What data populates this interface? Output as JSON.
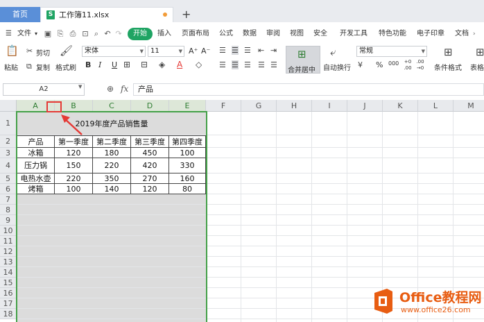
{
  "titlebar": {
    "home_tab": "首页",
    "file_tab": "工作簿11.xlsx",
    "file_icon": "S",
    "new_tab": "+"
  },
  "menubar": {
    "file_menu": "文件",
    "start_tab": "开始",
    "tabs": [
      "插入",
      "页面布局",
      "公式",
      "数据",
      "审阅",
      "视图",
      "安全",
      "开发工具",
      "特色功能",
      "电子印章",
      "文档"
    ]
  },
  "ribbon": {
    "paste": "粘贴",
    "cut": "剪切",
    "copy": "复制",
    "format_painter": "格式刷",
    "font_name": "宋体",
    "font_size": "11",
    "font_grow": "A⁺",
    "font_shrink": "A⁻",
    "bold": "B",
    "italic": "I",
    "underline": "U",
    "font_color_letter": "A",
    "merge_center": "合并居中",
    "wrap_text": "自动换行",
    "number_format": "常规",
    "percent": "%",
    "thousands": "000",
    "inc_decimal_top": "+0",
    "inc_decimal_bottom": ".00",
    "dec_decimal_top": ".00",
    "dec_decimal_bottom": "→0",
    "conditional_format": "条件格式",
    "table_style": "表格",
    "accent_green": "#1fa463",
    "text_red": "#e53935"
  },
  "formulabar": {
    "cell_ref": "A2",
    "fx_label": "fx",
    "content": "产品"
  },
  "sheet": {
    "columns": [
      "A",
      "B",
      "C",
      "D",
      "E",
      "F",
      "G",
      "H",
      "I",
      "J",
      "K",
      "L",
      "M"
    ],
    "rows": [
      "1",
      "2",
      "3",
      "4",
      "5",
      "6",
      "7",
      "8",
      "9",
      "10",
      "11",
      "12",
      "13",
      "14",
      "15",
      "16",
      "17",
      "18"
    ],
    "title": "2019年度产品销售量",
    "headers": [
      "产品",
      "第一季度",
      "第二季度",
      "第三季度",
      "第四季度"
    ],
    "data": [
      [
        "冰箱",
        "120",
        "180",
        "450",
        "100"
      ],
      [
        "压力锅",
        "150",
        "220",
        "420",
        "330"
      ],
      [
        "电热水壶",
        "220",
        "350",
        "270",
        "160"
      ],
      [
        "烤箱",
        "100",
        "140",
        "120",
        "80"
      ]
    ],
    "selection_color": "#43a047",
    "annotation_color": "#e53935"
  },
  "watermark": {
    "title": "Office教程网",
    "url": "www.office26.com",
    "color": "#e85d12"
  }
}
